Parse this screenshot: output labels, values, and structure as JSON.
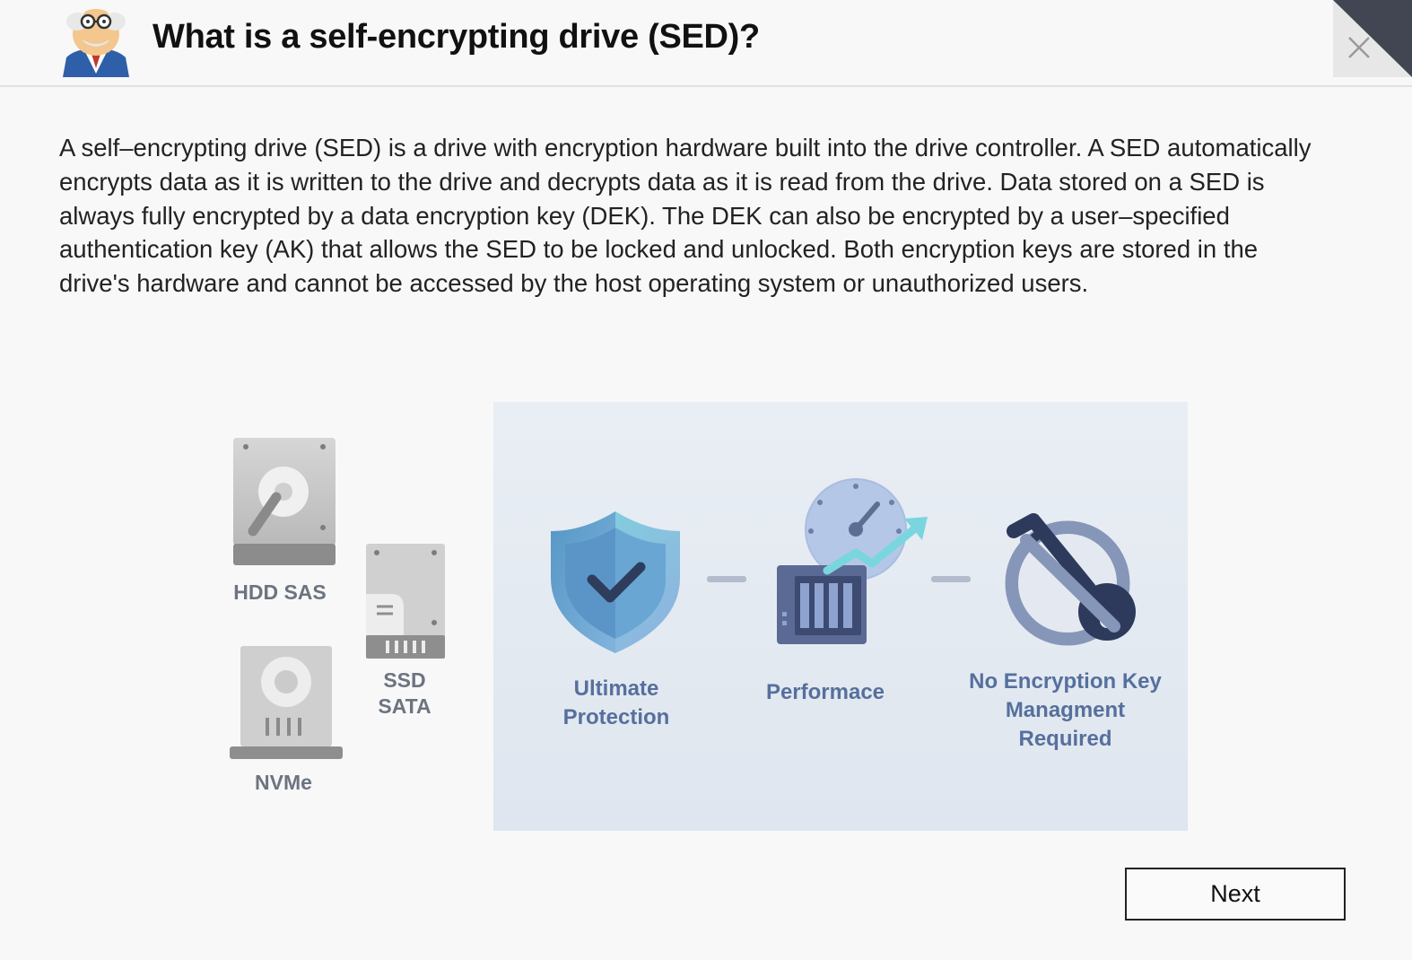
{
  "header": {
    "title": "What is a self-encrypting drive (SED)?",
    "close_icon": "close-icon",
    "mascot_icon": "professor-mascot-icon"
  },
  "description": "A self–encrypting drive (SED) is a drive with encryption hardware built into the drive controller. A SED automatically encrypts data as it is written to the drive and decrypts data as it is read from the drive. Data stored on a SED is always fully encrypted by a data encryption key (DEK). The DEK can also be encrypted by a user–specified authentication key (AK) that allows the SED to be locked and unlocked. Both encryption keys are stored in the drive's hardware and cannot be accessed by the host operating system or unauthorized users.",
  "illustration": {
    "drives": {
      "hdd": "HDD SAS",
      "ssd_line1": "SSD",
      "ssd_line2": "SATA",
      "nvme": "NVMe"
    },
    "features": {
      "protection_line1": "Ultimate",
      "protection_line2": "Protection",
      "performance": "Performace",
      "key_line1": "No Encryption Key",
      "key_line2": "Managment",
      "key_line3": "Required"
    }
  },
  "footer": {
    "next_label": "Next"
  }
}
